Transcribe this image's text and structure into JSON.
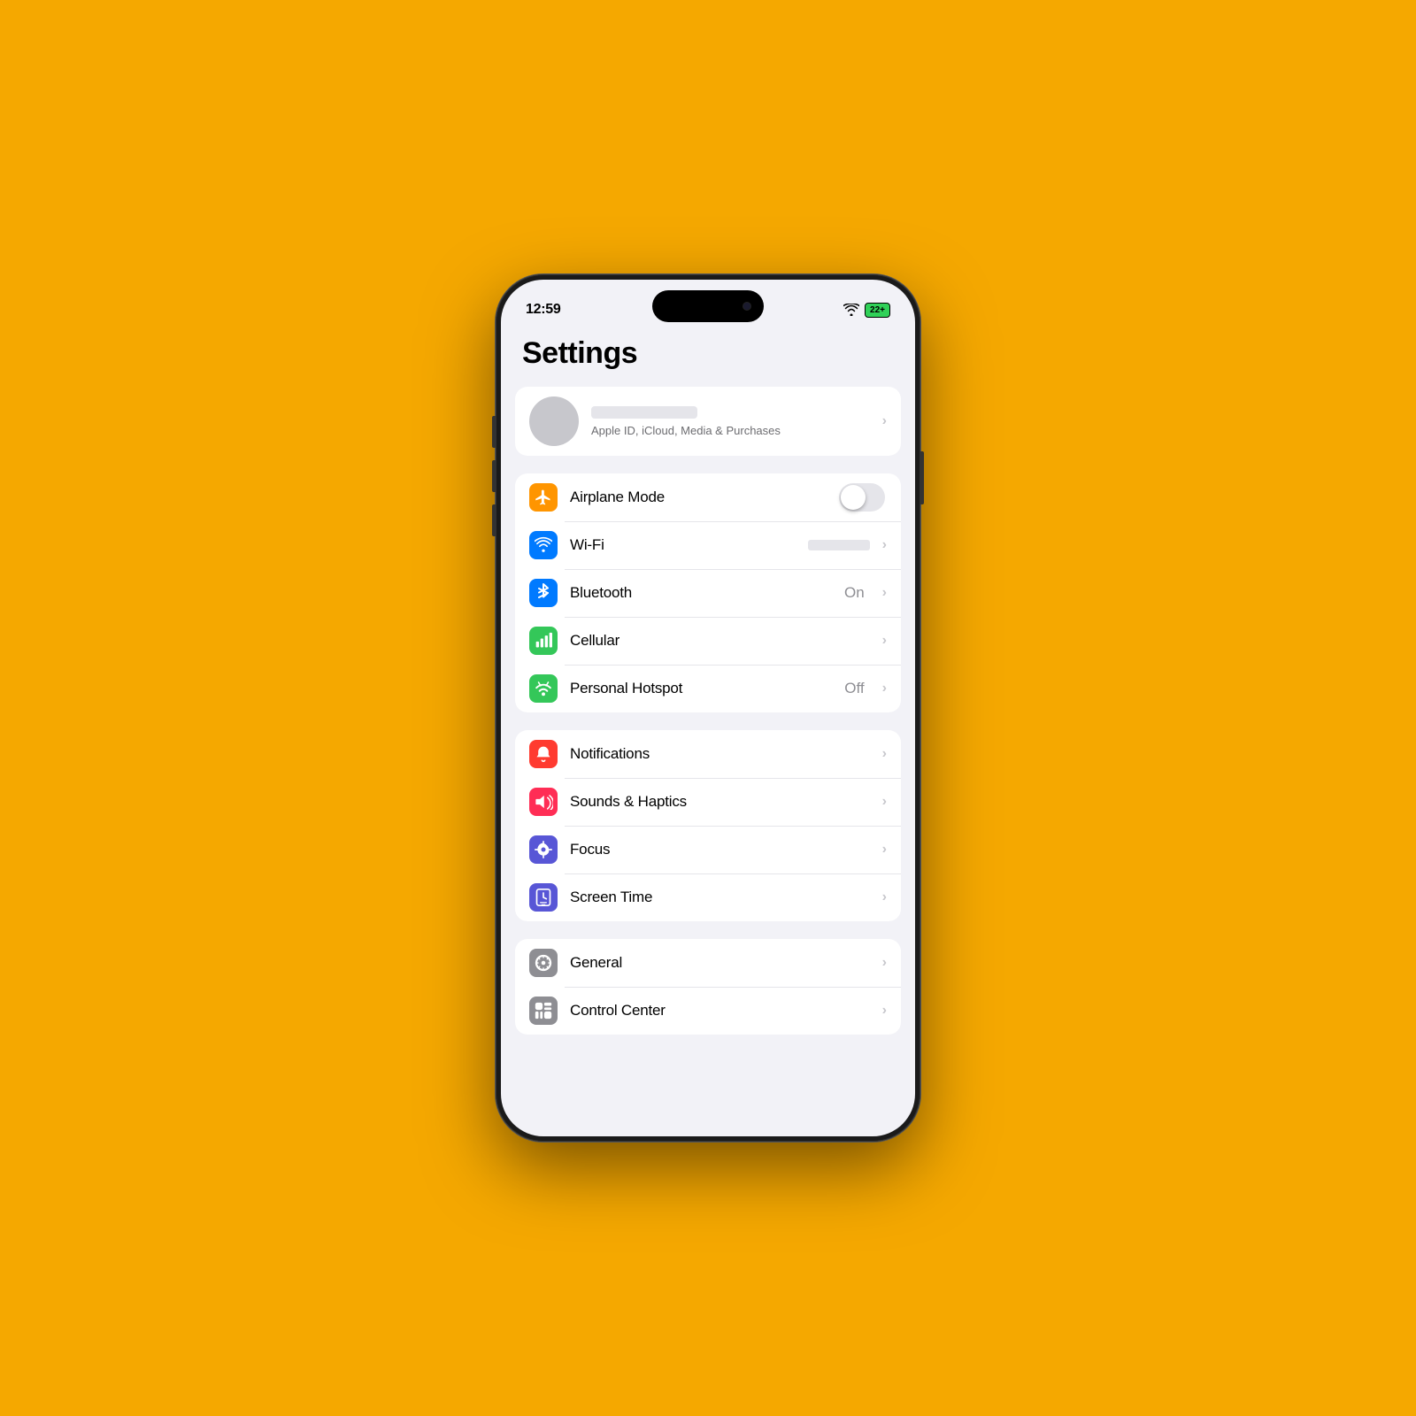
{
  "background": "#F5A800",
  "statusBar": {
    "time": "12:59",
    "battery": "22+",
    "wifiIcon": "wifi"
  },
  "pageTitle": "Settings",
  "appleId": {
    "subtitle": "Apple ID, iCloud, Media & Purchases",
    "chevron": "›"
  },
  "sections": [
    {
      "id": "connectivity",
      "items": [
        {
          "id": "airplane-mode",
          "label": "Airplane Mode",
          "iconColor": "icon-orange",
          "iconType": "airplane",
          "toggle": true,
          "toggleOn": false
        },
        {
          "id": "wifi",
          "label": "Wi-Fi",
          "iconColor": "icon-blue",
          "iconType": "wifi",
          "valueBar": true,
          "chevron": "›"
        },
        {
          "id": "bluetooth",
          "label": "Bluetooth",
          "iconColor": "icon-blue-light",
          "iconType": "bluetooth",
          "value": "On",
          "chevron": "›"
        },
        {
          "id": "cellular",
          "label": "Cellular",
          "iconColor": "icon-green",
          "iconType": "cellular",
          "chevron": "›"
        },
        {
          "id": "personal-hotspot",
          "label": "Personal Hotspot",
          "iconColor": "icon-green2",
          "iconType": "hotspot",
          "value": "Off",
          "chevron": "›"
        }
      ]
    },
    {
      "id": "system",
      "items": [
        {
          "id": "notifications",
          "label": "Notifications",
          "iconColor": "icon-red",
          "iconType": "bell",
          "chevron": "›"
        },
        {
          "id": "sounds-haptics",
          "label": "Sounds & Haptics",
          "iconColor": "icon-pink",
          "iconType": "sound",
          "chevron": "›"
        },
        {
          "id": "focus",
          "label": "Focus",
          "iconColor": "icon-purple",
          "iconType": "moon",
          "chevron": "›"
        },
        {
          "id": "screen-time",
          "label": "Screen Time",
          "iconColor": "icon-indigo",
          "iconType": "hourglass",
          "chevron": "›"
        }
      ]
    },
    {
      "id": "general-section",
      "items": [
        {
          "id": "general",
          "label": "General",
          "iconColor": "icon-gray",
          "iconType": "gear",
          "chevron": "›"
        },
        {
          "id": "control-center",
          "label": "Control Center",
          "iconColor": "icon-gray",
          "iconType": "sliders",
          "chevron": "›"
        }
      ]
    }
  ],
  "chevronChar": "›"
}
